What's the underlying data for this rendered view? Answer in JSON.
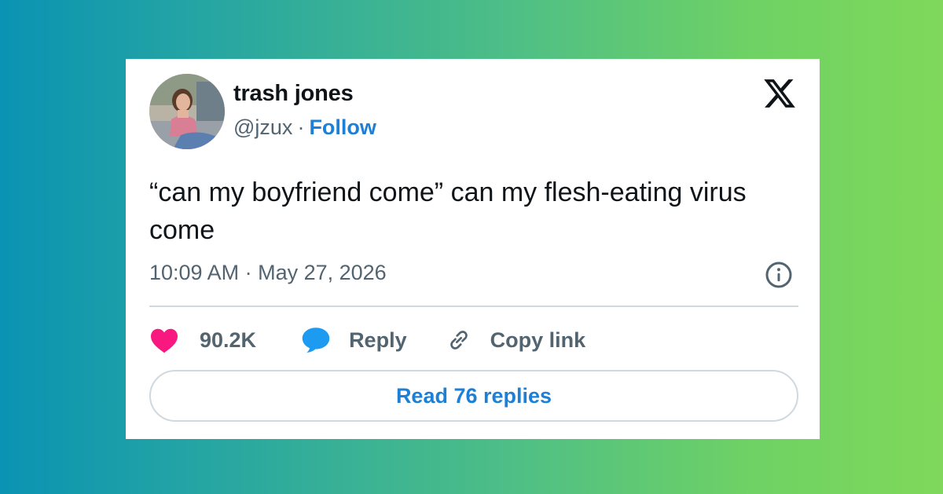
{
  "author": {
    "display_name": "trash jones",
    "handle": "@jzux",
    "separator": "·",
    "follow_label": "Follow"
  },
  "tweet": {
    "text": "“can my boyfriend come” can my flesh-eating virus come",
    "timestamp": "10:09 AM · May 27, 2026"
  },
  "actions": {
    "like_count": "90.2K",
    "reply_label": "Reply",
    "copy_link_label": "Copy link"
  },
  "read_replies_label": "Read 76 replies",
  "icons": {
    "logo": "x-logo-icon",
    "info": "info-icon",
    "like": "heart-icon",
    "reply": "speech-bubble-icon",
    "copy_link": "link-icon"
  },
  "colors": {
    "accent": "#1d7fd6",
    "heart": "#f91880",
    "reply_bubble": "#1d9bf0",
    "secondary_text": "#536471",
    "primary_text": "#0f1419"
  }
}
